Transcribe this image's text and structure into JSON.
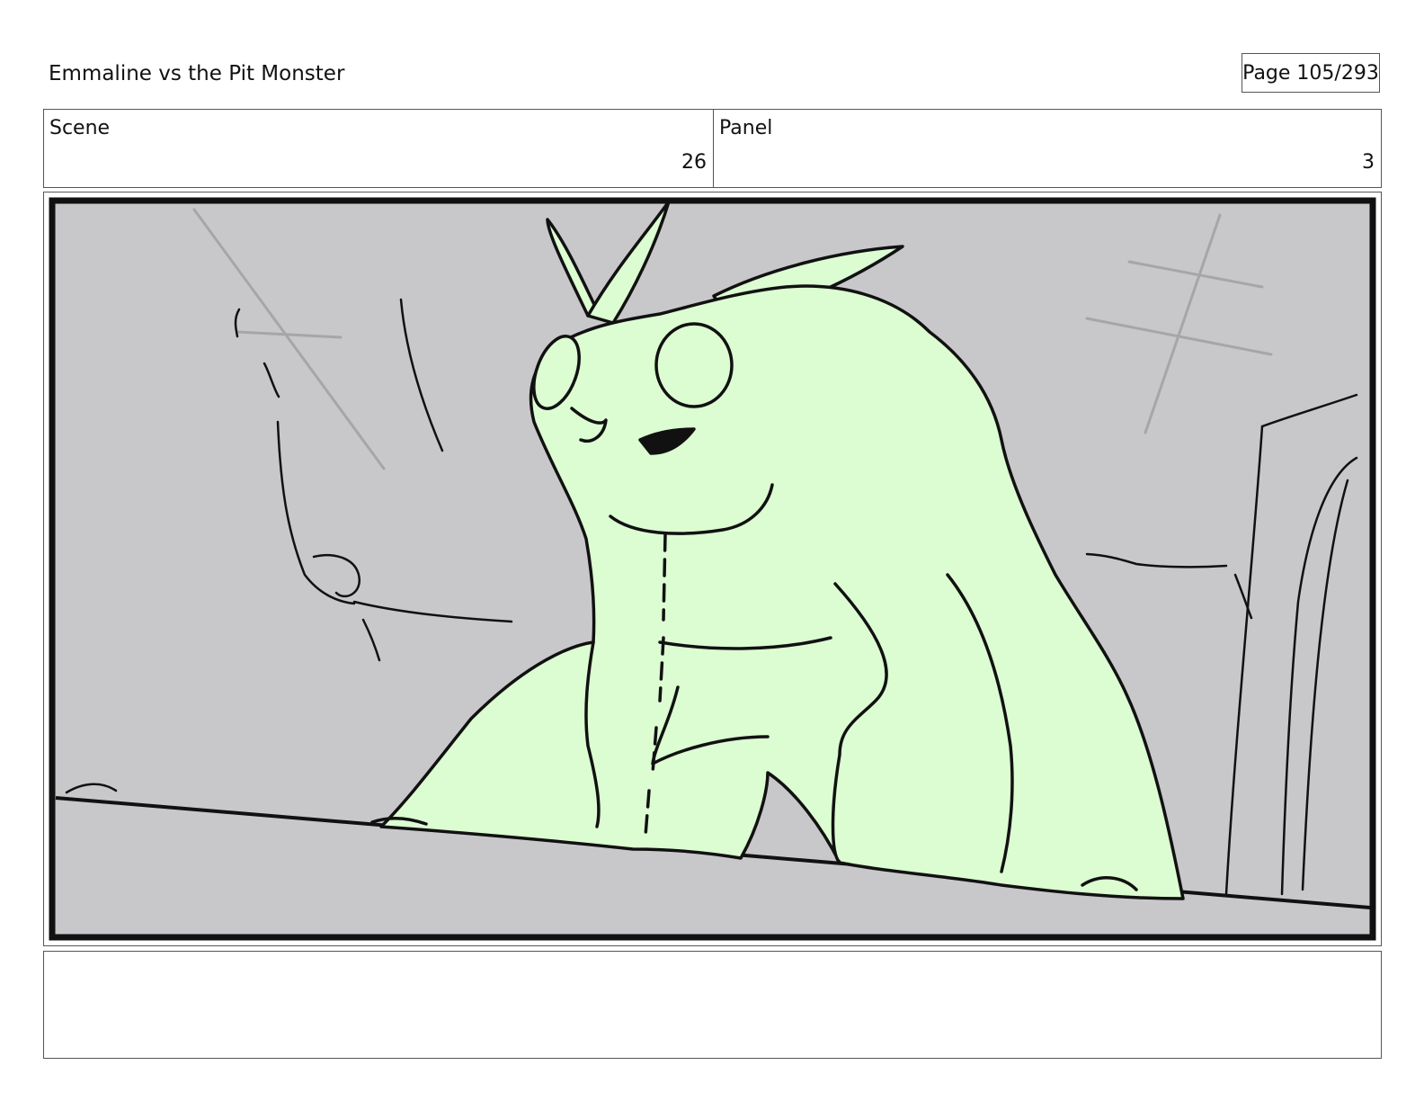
{
  "header": {
    "title": "Emmaline vs the Pit Monster",
    "page": "Page 105/293"
  },
  "info": {
    "scene_label": "Scene",
    "scene_value": "26",
    "panel_label": "Panel",
    "panel_value": "3"
  },
  "drawing": {
    "background_color": "#c8c8ca",
    "monster_color": "#dcfcd2",
    "line_color": "#111111"
  },
  "notes": {
    "text": ""
  }
}
